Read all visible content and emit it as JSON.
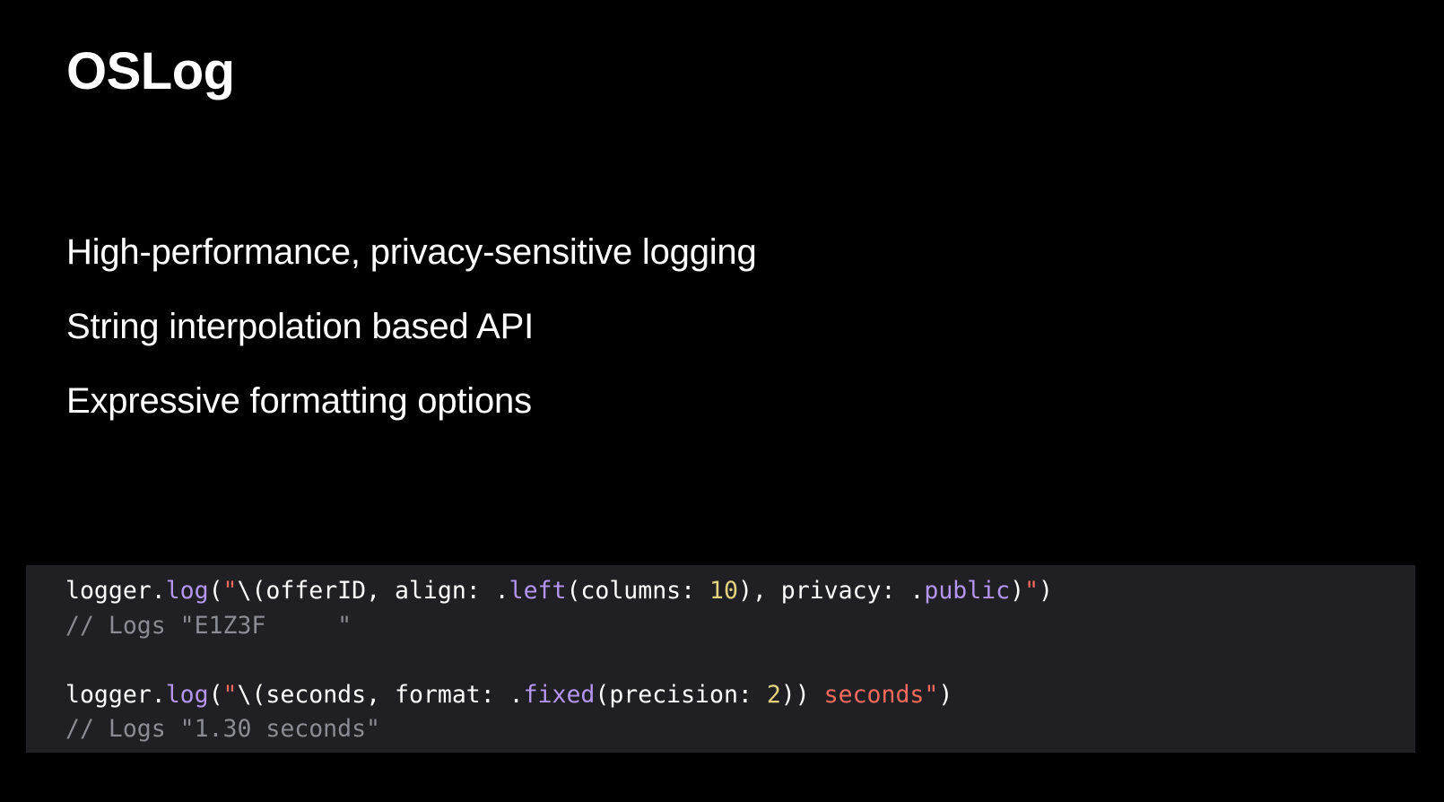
{
  "slide": {
    "title": "OSLog",
    "bullets": [
      "High-performance, privacy-sensitive logging",
      "String interpolation based API",
      "Expressive formatting options"
    ]
  },
  "code": {
    "line1": {
      "receiver": "logger.",
      "method": "log",
      "open": "(",
      "quote_open": "\"",
      "interp_open": "\\(offerID, align: .",
      "align_fn": "left",
      "columns_label": "(columns: ",
      "columns_value": "10",
      "privacy_label": "), privacy: .",
      "privacy_value": "public",
      "interp_close": ")",
      "quote_close": "\"",
      "close": ")"
    },
    "comment1": "// Logs \"E1Z3F     \"",
    "line2": {
      "receiver": "logger.",
      "method": "log",
      "open": "(",
      "quote_open": "\"",
      "interp_open": "\\(seconds, format: .",
      "format_fn": "fixed",
      "precision_label": "(precision: ",
      "precision_value": "2",
      "interp_close": "))",
      "literal": " seconds",
      "quote_close": "\"",
      "close": ")"
    },
    "comment2": "// Logs \"1.30 seconds\""
  },
  "colors": {
    "background": "#000000",
    "code_panel": "#1f1f24",
    "method": "#b496f0",
    "number": "#e3d27e",
    "string": "#fc6a5d",
    "comment": "#8a8b93",
    "text": "#ffffff"
  }
}
